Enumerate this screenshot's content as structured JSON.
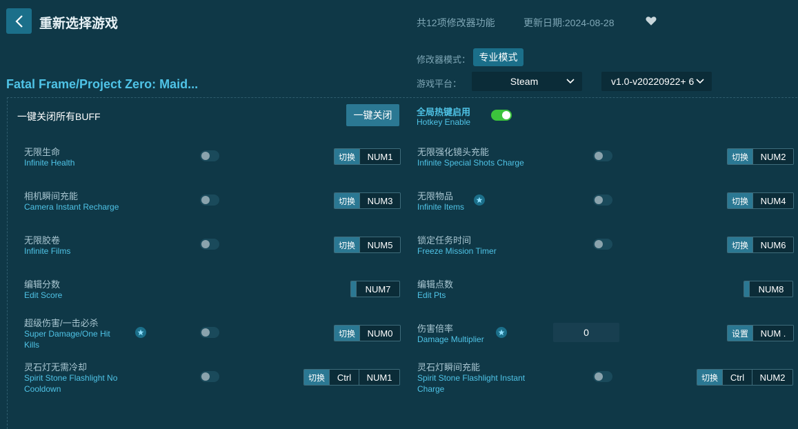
{
  "header": {
    "back_icon": "chevron-left-icon",
    "title": "重新选择游戏",
    "feature_count": "共12项修改器功能",
    "update_date": "更新日期:2024-08-28",
    "favorite_icon": "heart-icon"
  },
  "settings": {
    "mode_label": "修改器模式：",
    "mode_value": "专业模式",
    "platform_label": "游戏平台：",
    "platform_value": "Steam",
    "version_value": "v1.0-v20220922+ 6"
  },
  "game_title": "Fatal Frame/Project Zero: Maid...",
  "toolbar": {
    "all_buff_label": "一键关闭所有BUFF",
    "close_all_button": "一键关闭",
    "hotkey_cn": "全局热键启用",
    "hotkey_en": "Hotkey Enable",
    "hotkey_enabled": true
  },
  "cheats": [
    {
      "cn": "无限生命",
      "en": "Infinite Health",
      "action": "切换",
      "keys": [
        "NUM1"
      ]
    },
    {
      "cn": "无限强化镜头充能",
      "en": "Infinite Special Shots Charge",
      "action": "切换",
      "keys": [
        "NUM2"
      ]
    },
    {
      "cn": "相机瞬间充能",
      "en": "Camera Instant Recharge",
      "action": "切换",
      "keys": [
        "NUM3"
      ]
    },
    {
      "cn": "无限物品",
      "en": "Infinite Items",
      "action": "切换",
      "keys": [
        "NUM4"
      ],
      "star": true
    },
    {
      "cn": "无限胶卷",
      "en": "Infinite Films",
      "action": "切换",
      "keys": [
        "NUM5"
      ]
    },
    {
      "cn": "锁定任务时间",
      "en": "Freeze Mission Timer",
      "action": "切换",
      "keys": [
        "NUM6"
      ]
    },
    {
      "cn": "编辑分数",
      "en": "Edit Score",
      "keys": [
        "NUM7"
      ]
    },
    {
      "cn": "编辑点数",
      "en": "Edit Pts",
      "keys": [
        "NUM8"
      ]
    },
    {
      "cn": "超级伤害/一击必杀",
      "en": "Super Damage/One Hit Kills",
      "action": "切换",
      "keys": [
        "NUM0"
      ],
      "star": true
    },
    {
      "cn": "伤害倍率",
      "en": "Damage Multiplier",
      "action": "设置",
      "keys": [
        "NUM ."
      ],
      "star": true,
      "value": "0"
    },
    {
      "cn": "灵石灯无需冷却",
      "en": "Spirit Stone Flashlight No Cooldown",
      "action": "切换",
      "keys": [
        "Ctrl",
        "NUM1"
      ]
    },
    {
      "cn": "灵石灯瞬间充能",
      "en": "Spirit Stone Flashlight Instant Charge",
      "action": "切换",
      "keys": [
        "Ctrl",
        "NUM2"
      ]
    }
  ],
  "colors": {
    "background": "#0f3847",
    "accent": "#1b6f8a",
    "label_blue": "#4fc3e6",
    "toggle_on": "#3cc33c"
  }
}
